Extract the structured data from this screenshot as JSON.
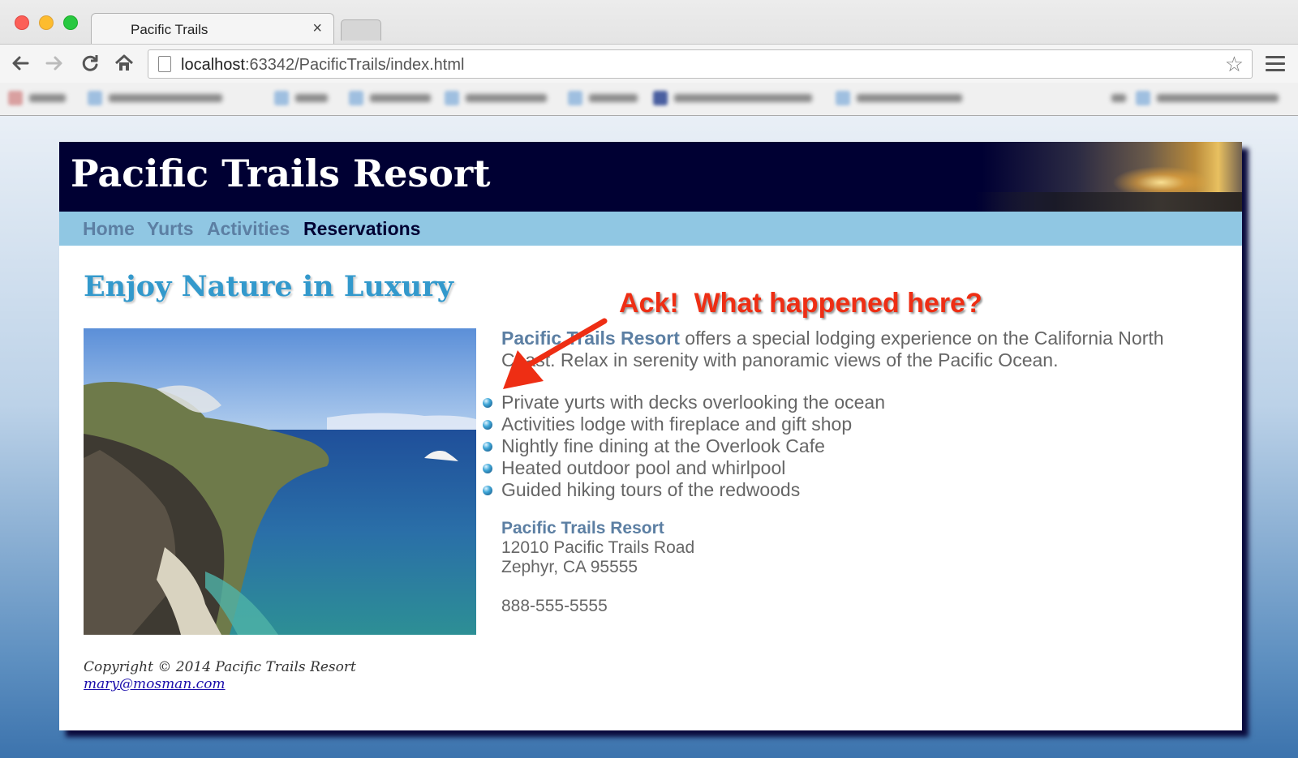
{
  "browser": {
    "tab_title": "Pacific Trails",
    "tab_close": "×",
    "url_host": "localhost",
    "url_rest": ":63342/PacificTrails/index.html",
    "bookmark_icon": "star-icon"
  },
  "site": {
    "title": "Pacific Trails Resort",
    "nav": [
      "Home",
      "Yurts",
      "Activities",
      "Reservations"
    ],
    "active_nav": "Reservations",
    "heading": "Enjoy Nature in Luxury",
    "intro_resort": "Pacific Trails Resort",
    "intro_text": " offers a special lodging experience on the California North Coast. Relax in serenity with panoramic views of the Pacific Ocean.",
    "features": [
      "Private yurts with decks overlooking the ocean",
      "Activities lodge with fireplace and gift shop",
      "Nightly fine dining at the Overlook Cafe",
      "Heated outdoor pool and whirlpool",
      "Guided hiking tours of the redwoods"
    ],
    "contact": {
      "name": "Pacific Trails Resort",
      "street": "12010 Pacific Trails Road",
      "city": "Zephyr, CA 95555",
      "phone": "888-555-5555"
    },
    "footer": {
      "copyright": "Copyright © 2014 Pacific Trails Resort",
      "email": "mary@mosman.com"
    }
  },
  "annotation": {
    "text": "Ack!  What happened here?",
    "color": "#ee2e14"
  },
  "colors": {
    "header_bg": "#000033",
    "nav_bg": "#90c7e3",
    "heading": "#3399cc",
    "accent_text": "#5c7fa3"
  }
}
